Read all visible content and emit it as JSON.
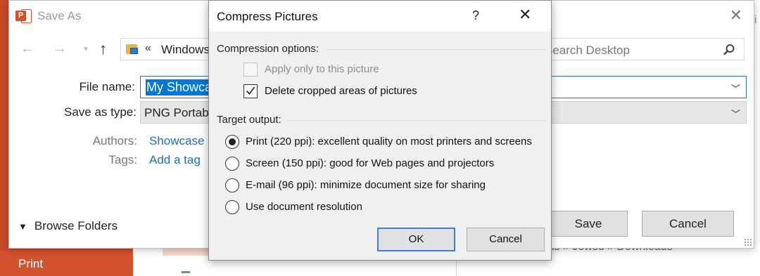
{
  "backstage": {
    "print_label": "Print",
    "path_text": "ls » Jewsd » Downloads",
    "cut_text": "di"
  },
  "save_as": {
    "title": "Save As",
    "address_chevron": "«",
    "address_text": "Windows",
    "search_placeholder": "Search Desktop",
    "file_name_label": "File name:",
    "file_name_value": "My Showca",
    "save_as_type_label": "Save as type:",
    "save_as_type_value": "PNG Portab",
    "authors_label": "Authors:",
    "authors_value": "Showcase",
    "tags_label": "Tags:",
    "tags_value": "Add a tag",
    "browse_folders_label": "Browse Folders",
    "save_button": "Save",
    "cancel_button": "Cancel"
  },
  "compress_dialog": {
    "title": "Compress Pictures",
    "help_glyph": "?",
    "compression_group_label": "Compression options:",
    "checkboxes": [
      {
        "label": "Apply only to this picture",
        "checked": false,
        "enabled": false
      },
      {
        "label": "Delete cropped areas of pictures",
        "checked": true,
        "enabled": true
      }
    ],
    "target_group_label": "Target output:",
    "radios": [
      {
        "label": "Print (220 ppi): excellent quality on most printers and screens",
        "selected": true
      },
      {
        "label": "Screen (150 ppi): good for Web pages and projectors",
        "selected": false
      },
      {
        "label": "E-mail (96 ppi): minimize document size for sharing",
        "selected": false
      },
      {
        "label": "Use document resolution",
        "selected": false
      }
    ],
    "ok_button": "OK",
    "cancel_button": "Cancel"
  },
  "colors": {
    "powerpoint_red": "#c9482b",
    "selection_blue": "#0078d7",
    "link_blue": "#1a6fbf",
    "default_button_border": "#3c7fcf"
  }
}
